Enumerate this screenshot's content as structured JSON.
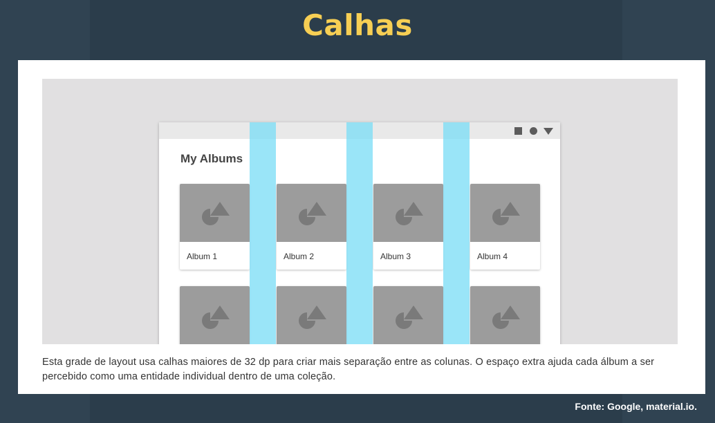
{
  "slide": {
    "title": "Calhas",
    "caption": "Esta grade de layout usa calhas maiores de 32 dp para criar mais separação entre as colunas. O espaço extra ajuda cada álbum a ser percebido como uma entidade individual dentro de uma coleção.",
    "source": "Fonte: Google, material.io.",
    "colors": {
      "title": "#f7cf54",
      "background": "#2b3d4b",
      "gutter": "#7edef6",
      "placeholder": "#9c9c9c"
    }
  },
  "mockup": {
    "heading": "My Albums",
    "status_icons": [
      "square-icon",
      "circle-icon",
      "triangle-icon"
    ],
    "albums_row1": [
      {
        "label": "Album 1"
      },
      {
        "label": "Album 2"
      },
      {
        "label": "Album 3"
      },
      {
        "label": "Album 4"
      }
    ]
  }
}
